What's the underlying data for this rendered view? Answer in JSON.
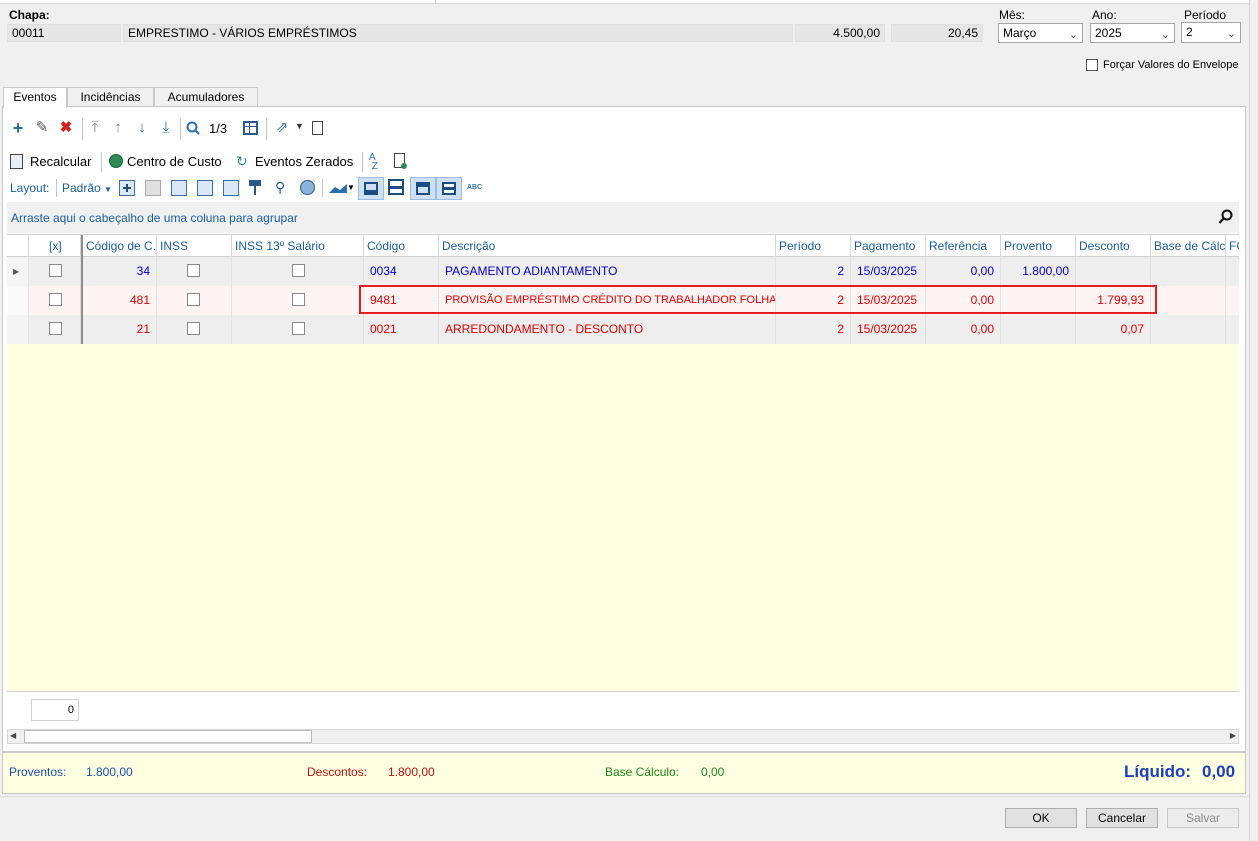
{
  "header": {
    "chapa_label": "Chapa:",
    "chapa_value": "00011",
    "description": "EMPRESTIMO - VÁRIOS EMPRÉSTIMOS",
    "amount": "4.500,00",
    "rate": "20,45",
    "mes_label": "Mês:",
    "mes_value": "Março",
    "ano_label": "Ano:",
    "ano_value": "2025",
    "periodo_label": "Período",
    "periodo_value": "2",
    "forcar_label": "Forçar Valores do Envelope"
  },
  "tabs": [
    {
      "label": "Eventos"
    },
    {
      "label": "Incidências"
    },
    {
      "label": "Acumuladores"
    }
  ],
  "toolbar": {
    "page_indicator": "1/3",
    "recalcular": "Recalcular",
    "centro_custo": "Centro de Custo",
    "eventos_zerados": "Eventos Zerados",
    "layout_label": "Layout:",
    "layout_value": "Padrão",
    "abc": "ABC"
  },
  "grid": {
    "group_hint": "Arraste aqui o cabeçalho de uma coluna para agrupar",
    "columns": [
      "[x]",
      "Código de C...",
      "INSS",
      "INSS 13º Salário",
      "Código",
      "Descrição",
      "Período",
      "Pagamento",
      "Referência",
      "Provento",
      "Desconto",
      "Base de Cálc...",
      "FG"
    ],
    "rows": [
      {
        "codc": "34",
        "codigo": "0034",
        "descricao": "PAGAMENTO ADIANTAMENTO",
        "periodo": "2",
        "pagamento": "15/03/2025",
        "referencia": "0,00",
        "provento": "1.800,00",
        "desconto": ""
      },
      {
        "codc": "481",
        "codigo": "9481",
        "descricao": "PROVISÃO EMPRÉSTIMO CRÉDITO DO TRABALHADOR FOLHA",
        "periodo": "2",
        "pagamento": "15/03/2025",
        "referencia": "0,00",
        "provento": "",
        "desconto": "1.799,93"
      },
      {
        "codc": "21",
        "codigo": "0021",
        "descricao": "ARREDONDAMENTO - DESCONTO",
        "periodo": "2",
        "pagamento": "15/03/2025",
        "referencia": "0,00",
        "provento": "",
        "desconto": "0,07"
      }
    ],
    "count_value": "0"
  },
  "totals": {
    "proventos_label": "Proventos:",
    "proventos_value": "1.800,00",
    "descontos_label": "Descontos:",
    "descontos_value": "1.800,00",
    "base_label": "Base Cálculo:",
    "base_value": "0,00",
    "liquido_label": "Líquido:",
    "liquido_value": "0,00"
  },
  "buttons": {
    "ok": "OK",
    "cancelar": "Cancelar",
    "salvar": "Salvar"
  },
  "colors": {
    "accent_blue": "#2a6fb5",
    "row_blue": "#0000d0",
    "row_red": "#e00000",
    "highlight_border": "#e02020",
    "yellow": "#ffffe1",
    "base_green": "#1a8a1a"
  }
}
